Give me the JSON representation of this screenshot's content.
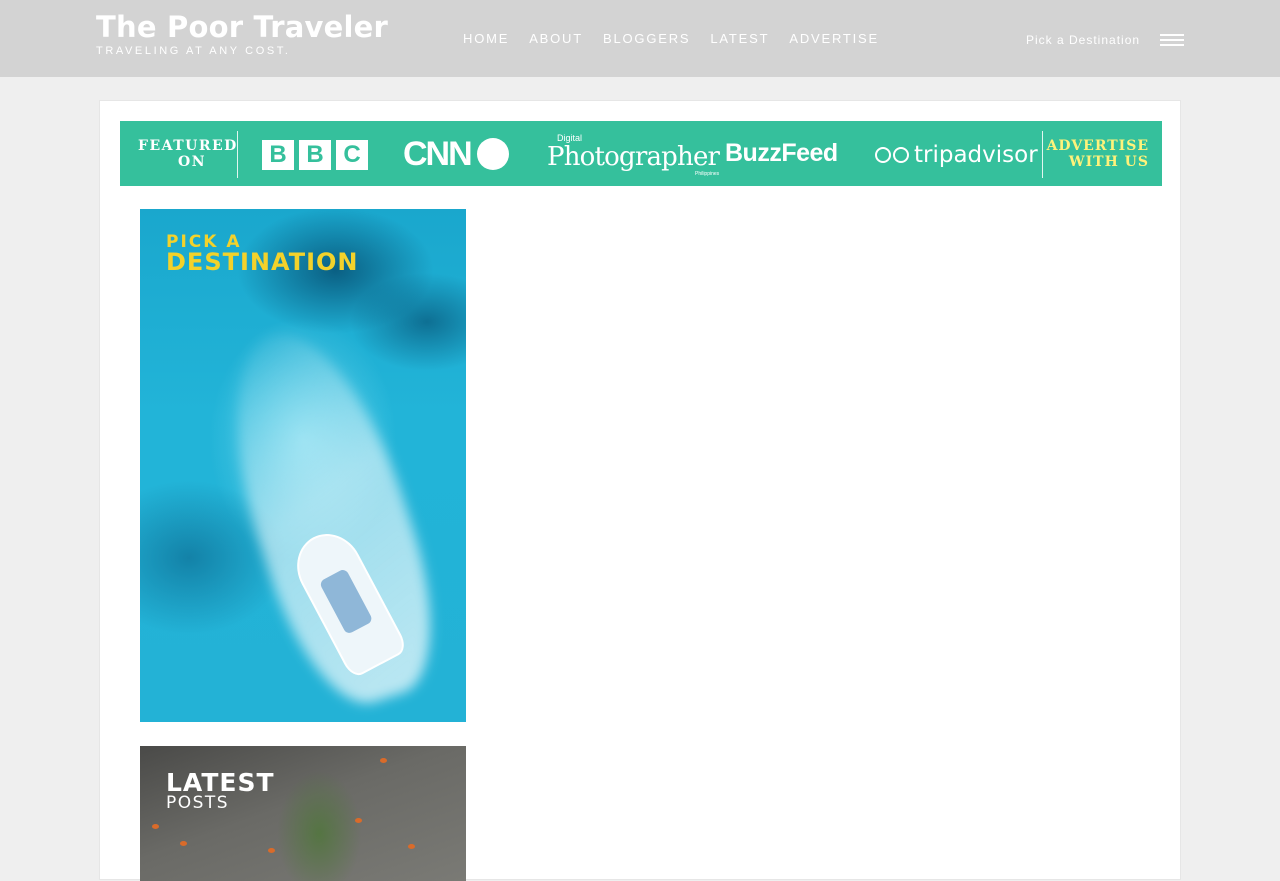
{
  "header": {
    "title": "The Poor Traveler",
    "tagline": "TRAVELING AT ANY COST.",
    "nav": [
      "HOME",
      "ABOUT",
      "BLOGGERS",
      "LATEST",
      "ADVERTISE"
    ],
    "destination_label": "Pick a Destination",
    "menu_icon": "hamburger-icon",
    "text_color": "#ffffff",
    "background_color": "#d3d3d3"
  },
  "banner": {
    "featured_line1": "FEATURED",
    "featured_line2": "ON",
    "bbc_letters": [
      "B",
      "B",
      "C"
    ],
    "cnn": "CNN",
    "photographer_small": "Digital",
    "photographer": "Photographer",
    "photographer_sub": "Philippines",
    "buzzfeed": "BuzzFeed",
    "tripadvisor": "tripadvisor",
    "advertise_line1": "ADVERTISE",
    "advertise_line2": "WITH US",
    "background_color": "#35c09c",
    "advertise_color": "#fff27a"
  },
  "cards": {
    "destination": {
      "line1": "PICK A",
      "line2": "DESTINATION",
      "title_color": "#f3d22b"
    },
    "latest": {
      "line1": "LATEST",
      "line2": "POSTS"
    }
  }
}
